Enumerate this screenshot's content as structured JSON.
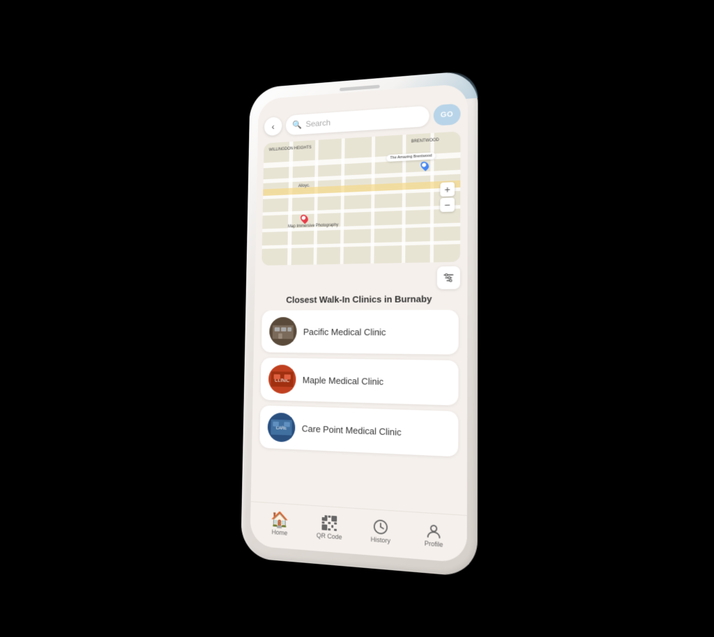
{
  "phone": {
    "speaker": "speaker",
    "back_button": "‹",
    "search_placeholder": "Search",
    "go_label": "GO",
    "section_title": "Closest Walk-In Clinics in Burnaby",
    "map": {
      "label_brentwood": "BRENTWOOD",
      "label_wellington": "WILLINGDON HEIGHTS",
      "label_alloyc": "Alloyc.",
      "label_amazing": "The Amazing Brentwood",
      "label_map_immersive": "Map Immersive Photography",
      "zoom_in": "+",
      "zoom_out": "−"
    },
    "filter_icon": "sliders",
    "clinics": [
      {
        "name": "Pacific Medical Clinic",
        "thumb_class": "thumb-pacific"
      },
      {
        "name": "Maple Medical Clinic",
        "thumb_class": "thumb-maple"
      },
      {
        "name": "Care Point Medical Clinic",
        "thumb_class": "thumb-carepoint"
      }
    ],
    "nav": [
      {
        "label": "Home",
        "icon": "🏠",
        "key": "home"
      },
      {
        "label": "QR Code",
        "icon": "qr",
        "key": "qrcode"
      },
      {
        "label": "History",
        "icon": "⏱",
        "key": "history"
      },
      {
        "label": "Profile",
        "icon": "👤",
        "key": "profile"
      }
    ]
  }
}
